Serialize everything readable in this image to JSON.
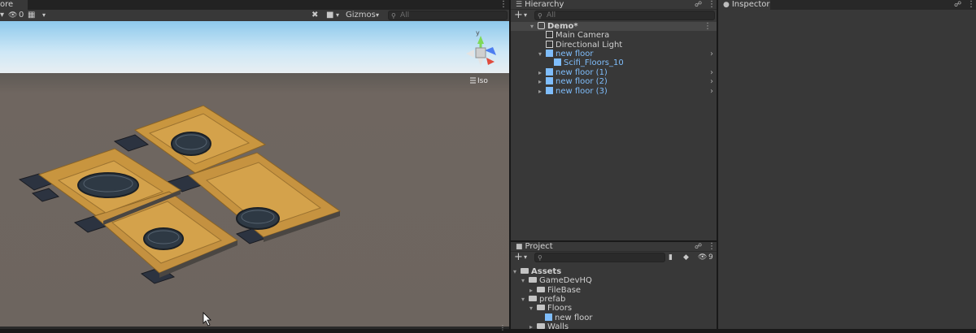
{
  "scene": {
    "tab_label": "ore",
    "hidden_count": "0",
    "gizmos_label": "Gizmos",
    "search_placeholder": "All",
    "projection_label": "Iso",
    "gizmo_axis_label": "y"
  },
  "hierarchy": {
    "tab_label": "Hierarchy",
    "search_placeholder": "All",
    "scene_name": "Demo*",
    "items": [
      {
        "label": "Main Camera",
        "icon": "cube-outline-icon"
      },
      {
        "label": "Directional Light",
        "icon": "cube-outline-icon"
      },
      {
        "label": "new floor",
        "icon": "prefab-cube-icon"
      },
      {
        "label": "Scifi_Floors_10",
        "icon": "prefab-cube-icon"
      },
      {
        "label": "new floor (1)",
        "icon": "prefab-cube-icon"
      },
      {
        "label": "new floor (2)",
        "icon": "prefab-cube-icon"
      },
      {
        "label": "new floor (3)",
        "icon": "prefab-cube-icon"
      }
    ]
  },
  "inspector": {
    "tab_label": "Inspector"
  },
  "project": {
    "tab_label": "Project",
    "hidden_count": "9",
    "tree": [
      {
        "label": "Assets"
      },
      {
        "label": "GameDevHQ"
      },
      {
        "label": "FileBase"
      },
      {
        "label": "prefab"
      },
      {
        "label": "Floors"
      },
      {
        "label": "new floor"
      },
      {
        "label": "Walls"
      }
    ]
  },
  "colors": {
    "panel": "#383838",
    "prefab_blue": "#7fbdfb",
    "floor_tan": "#c8953f",
    "sky": "#9fd0ee"
  }
}
